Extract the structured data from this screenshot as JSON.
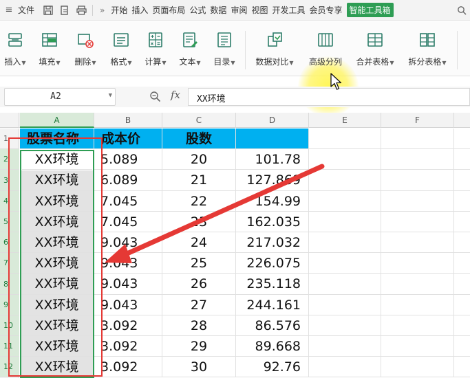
{
  "menubar": {
    "file_label": "文件",
    "more_label": "»",
    "tabs": [
      {
        "label": "开始",
        "active": false
      },
      {
        "label": "插入",
        "active": false
      },
      {
        "label": "页面布局",
        "active": false
      },
      {
        "label": "公式",
        "active": false
      },
      {
        "label": "数据",
        "active": false
      },
      {
        "label": "审阅",
        "active": false
      },
      {
        "label": "视图",
        "active": false
      },
      {
        "label": "开发工具",
        "active": false
      },
      {
        "label": "会员专享",
        "active": false
      },
      {
        "label": "智能工具箱",
        "active": true
      }
    ]
  },
  "ribbon": {
    "buttons": [
      {
        "label": "插入",
        "has_dropdown": true,
        "icon": "insert-rows-icon"
      },
      {
        "label": "填充",
        "has_dropdown": true,
        "icon": "fill-icon"
      },
      {
        "label": "删除",
        "has_dropdown": true,
        "icon": "delete-icon"
      },
      {
        "label": "格式",
        "has_dropdown": true,
        "icon": "format-icon"
      },
      {
        "label": "计算",
        "has_dropdown": true,
        "icon": "calculate-icon"
      },
      {
        "label": "文本",
        "has_dropdown": true,
        "icon": "text-icon"
      },
      {
        "label": "目录",
        "has_dropdown": true,
        "icon": "toc-icon"
      },
      {
        "label": "数据对比",
        "has_dropdown": true,
        "icon": "data-compare-icon"
      },
      {
        "label": "高级分列",
        "has_dropdown": false,
        "icon": "advanced-split-icon"
      },
      {
        "label": "合并表格",
        "has_dropdown": true,
        "icon": "merge-tables-icon"
      },
      {
        "label": "拆分表格",
        "has_dropdown": true,
        "icon": "split-table-icon"
      }
    ]
  },
  "formula_bar": {
    "cell_ref": "A2",
    "fx_label": "fx",
    "content": "XX环境"
  },
  "grid": {
    "columns": [
      "A",
      "B",
      "C",
      "D",
      "E",
      "F"
    ],
    "selected_column": "A",
    "header_row": {
      "a": "股票名称",
      "b": "成本价",
      "c": "股数",
      "d": ""
    },
    "rows": [
      {
        "num": "1"
      },
      {
        "num": "2",
        "a": "XX环境",
        "b": "5.089",
        "c": "20",
        "d": "101.78"
      },
      {
        "num": "3",
        "a": "XX环境",
        "b": "6.089",
        "c": "21",
        "d": "127.869"
      },
      {
        "num": "4",
        "a": "XX环境",
        "b": "7.045",
        "c": "22",
        "d": "154.99"
      },
      {
        "num": "5",
        "a": "XX环境",
        "b": "7.045",
        "c": "23",
        "d": "162.035"
      },
      {
        "num": "6",
        "a": "XX环境",
        "b": "9.043",
        "c": "24",
        "d": "217.032"
      },
      {
        "num": "7",
        "a": "XX环境",
        "b": "9.043",
        "c": "25",
        "d": "226.075"
      },
      {
        "num": "8",
        "a": "XX环境",
        "b": "9.043",
        "c": "26",
        "d": "235.118"
      },
      {
        "num": "9",
        "a": "XX环境",
        "b": "9.043",
        "c": "27",
        "d": "244.161"
      },
      {
        "num": "10",
        "a": "XX环境",
        "b": "3.092",
        "c": "28",
        "d": "86.576"
      },
      {
        "num": "11",
        "a": "XX环境",
        "b": "3.092",
        "c": "29",
        "d": "89.668"
      },
      {
        "num": "12",
        "a": "XX环境",
        "b": "3.092",
        "c": "30",
        "d": "92.76"
      }
    ]
  },
  "colors": {
    "header_fill": "#00b0f0",
    "active_tab": "#2e9d54",
    "selection_border": "#2e9d54",
    "annotation_red": "#e53935",
    "cursor_highlight": "#fff250"
  }
}
